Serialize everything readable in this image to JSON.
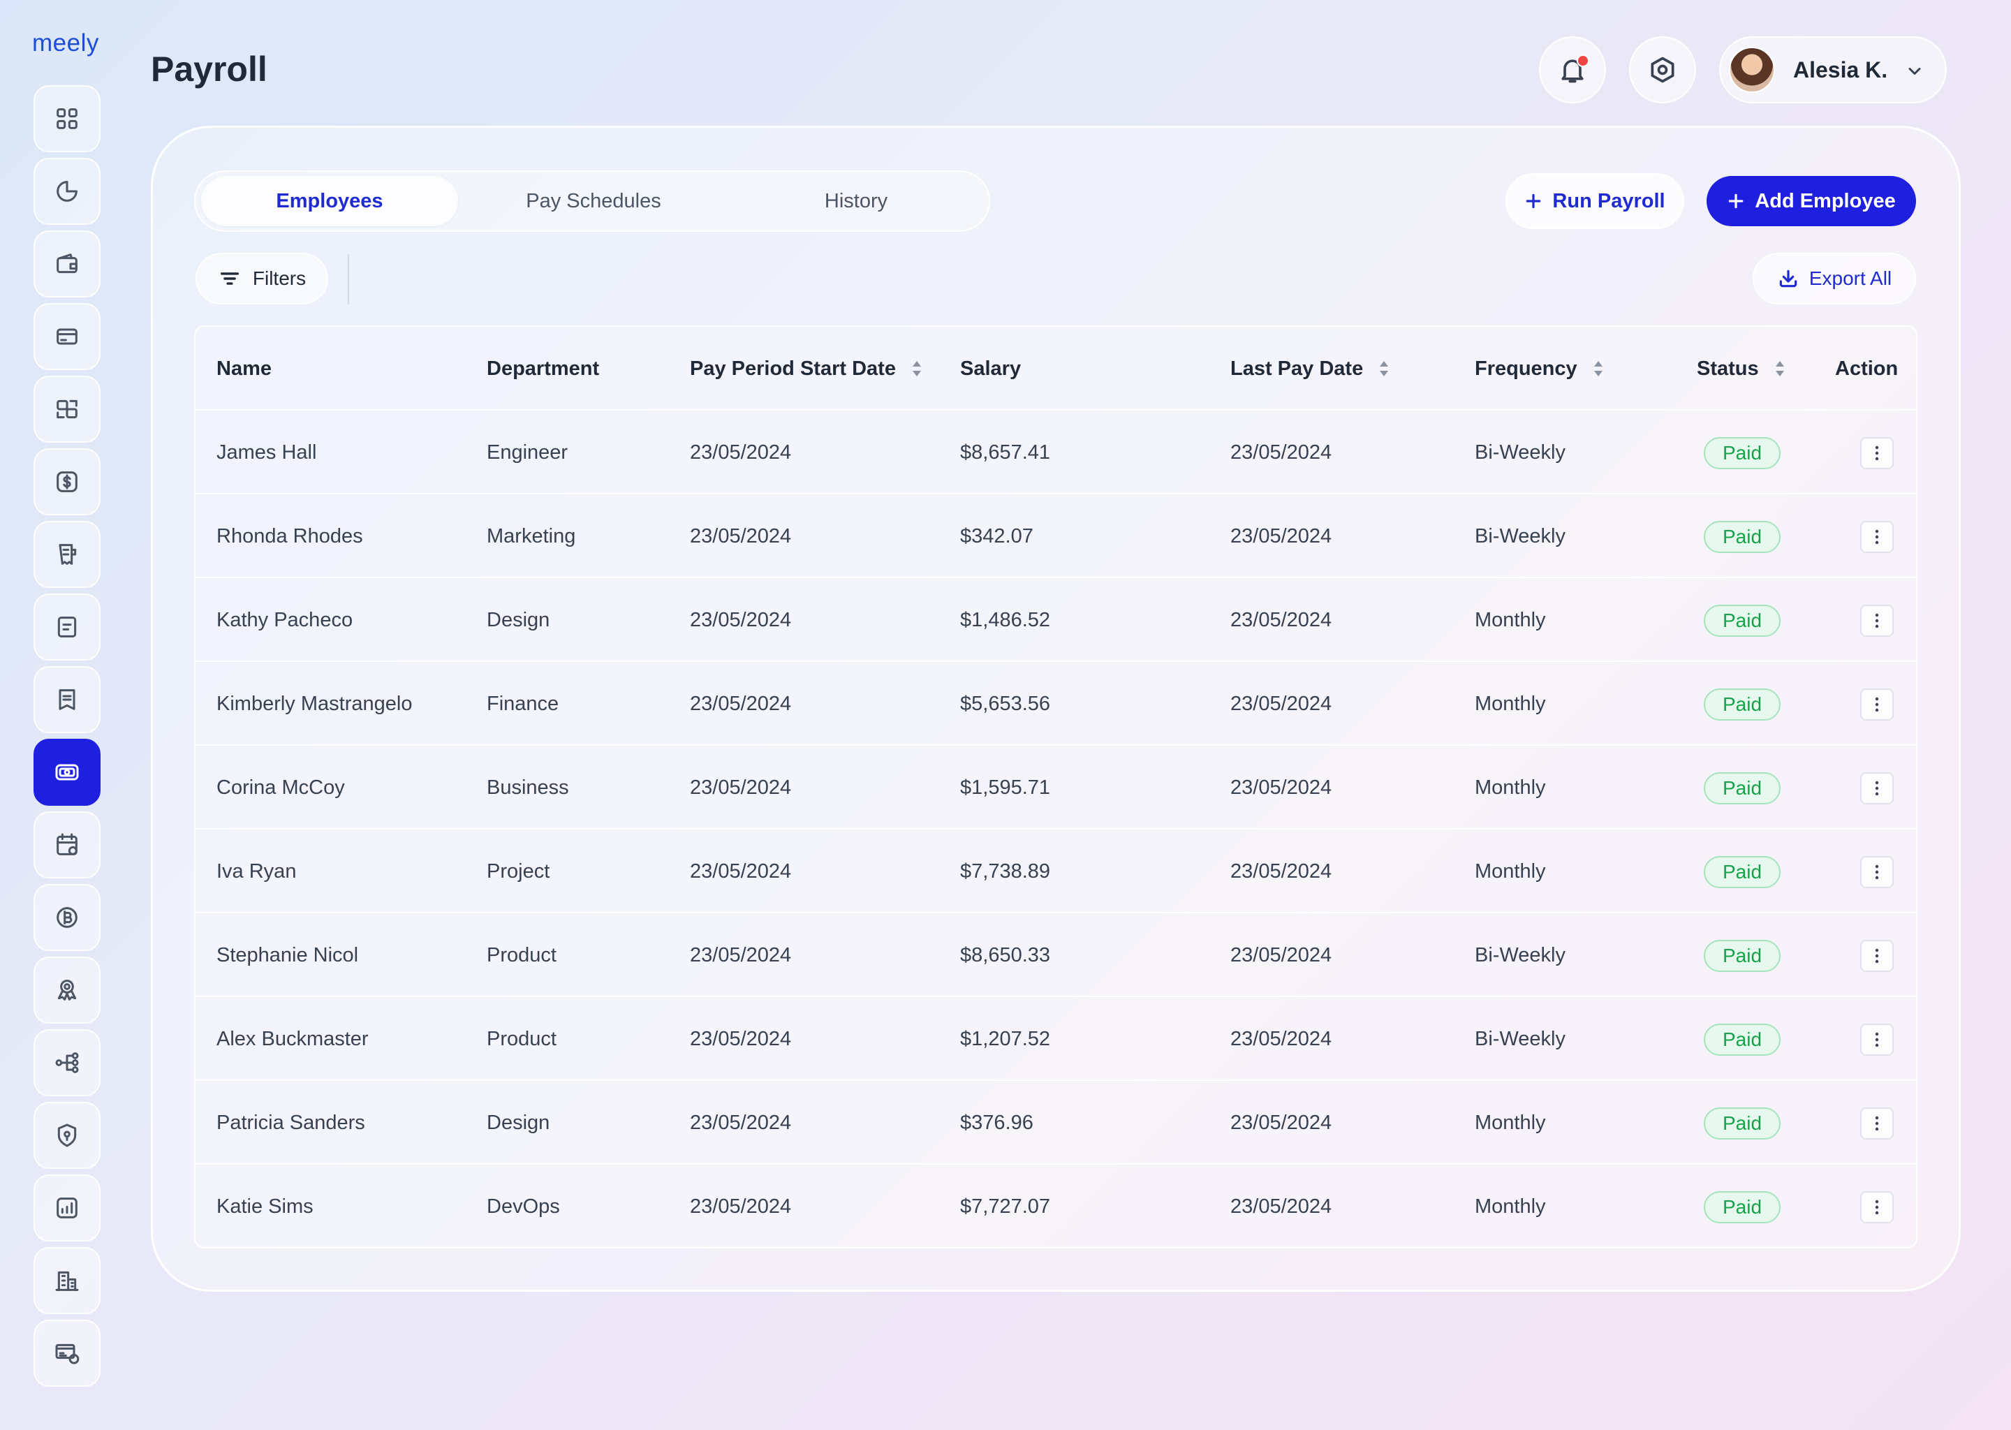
{
  "app": {
    "logo": "meely"
  },
  "header": {
    "title": "Payroll",
    "user_name": "Alesia K."
  },
  "sidebar": {
    "items": [
      {
        "icon": "grid-icon"
      },
      {
        "icon": "pie-chart-icon"
      },
      {
        "icon": "wallet-icon"
      },
      {
        "icon": "credit-card-icon"
      },
      {
        "icon": "transfer-icon"
      },
      {
        "icon": "dollar-icon"
      },
      {
        "icon": "receipt-icon"
      },
      {
        "icon": "document-icon"
      },
      {
        "icon": "invoice-icon"
      },
      {
        "icon": "payroll-money-icon",
        "active": true
      },
      {
        "icon": "calendar-icon"
      },
      {
        "icon": "bitcoin-icon"
      },
      {
        "icon": "award-icon"
      },
      {
        "icon": "flow-icon"
      },
      {
        "icon": "shield-icon"
      },
      {
        "icon": "analytics-icon"
      },
      {
        "icon": "building-icon"
      },
      {
        "icon": "cards-icon"
      }
    ]
  },
  "tabs": [
    {
      "label": "Employees",
      "active": true
    },
    {
      "label": "Pay Schedules",
      "active": false
    },
    {
      "label": "History",
      "active": false
    }
  ],
  "actions": {
    "run_payroll": "Run Payroll",
    "add_employee": "Add Employee",
    "filters": "Filters",
    "export_all": "Export All"
  },
  "colors": {
    "accent": "#1f1fe0",
    "status_paid": "#16a34a",
    "notification": "#ef4444"
  },
  "table": {
    "columns": [
      "Name",
      "Department",
      "Pay Period Start Date",
      "Salary",
      "Last Pay Date",
      "Frequency",
      "Status",
      "Action"
    ],
    "sortable": [
      "Pay Period Start Date",
      "Last Pay Date",
      "Frequency",
      "Status"
    ],
    "rows": [
      {
        "name": "James Hall",
        "department": "Engineer",
        "start": "23/05/2024",
        "salary": "$8,657.41",
        "last": "23/05/2024",
        "frequency": "Bi-Weekly",
        "status": "Paid"
      },
      {
        "name": "Rhonda Rhodes",
        "department": "Marketing",
        "start": "23/05/2024",
        "salary": "$342.07",
        "last": "23/05/2024",
        "frequency": "Bi-Weekly",
        "status": "Paid"
      },
      {
        "name": "Kathy Pacheco",
        "department": "Design",
        "start": "23/05/2024",
        "salary": "$1,486.52",
        "last": "23/05/2024",
        "frequency": "Monthly",
        "status": "Paid"
      },
      {
        "name": "Kimberly Mastrangelo",
        "department": "Finance",
        "start": "23/05/2024",
        "salary": "$5,653.56",
        "last": "23/05/2024",
        "frequency": "Monthly",
        "status": "Paid"
      },
      {
        "name": "Corina McCoy",
        "department": "Business",
        "start": "23/05/2024",
        "salary": "$1,595.71",
        "last": "23/05/2024",
        "frequency": "Monthly",
        "status": "Paid"
      },
      {
        "name": "Iva Ryan",
        "department": "Project",
        "start": "23/05/2024",
        "salary": "$7,738.89",
        "last": "23/05/2024",
        "frequency": "Monthly",
        "status": "Paid"
      },
      {
        "name": "Stephanie Nicol",
        "department": "Product",
        "start": "23/05/2024",
        "salary": "$8,650.33",
        "last": "23/05/2024",
        "frequency": "Bi-Weekly",
        "status": "Paid"
      },
      {
        "name": "Alex Buckmaster",
        "department": "Product",
        "start": "23/05/2024",
        "salary": "$1,207.52",
        "last": "23/05/2024",
        "frequency": "Bi-Weekly",
        "status": "Paid"
      },
      {
        "name": "Patricia Sanders",
        "department": "Design",
        "start": "23/05/2024",
        "salary": "$376.96",
        "last": "23/05/2024",
        "frequency": "Monthly",
        "status": "Paid"
      },
      {
        "name": "Katie Sims",
        "department": "DevOps",
        "start": "23/05/2024",
        "salary": "$7,727.07",
        "last": "23/05/2024",
        "frequency": "Monthly",
        "status": "Paid"
      }
    ]
  }
}
